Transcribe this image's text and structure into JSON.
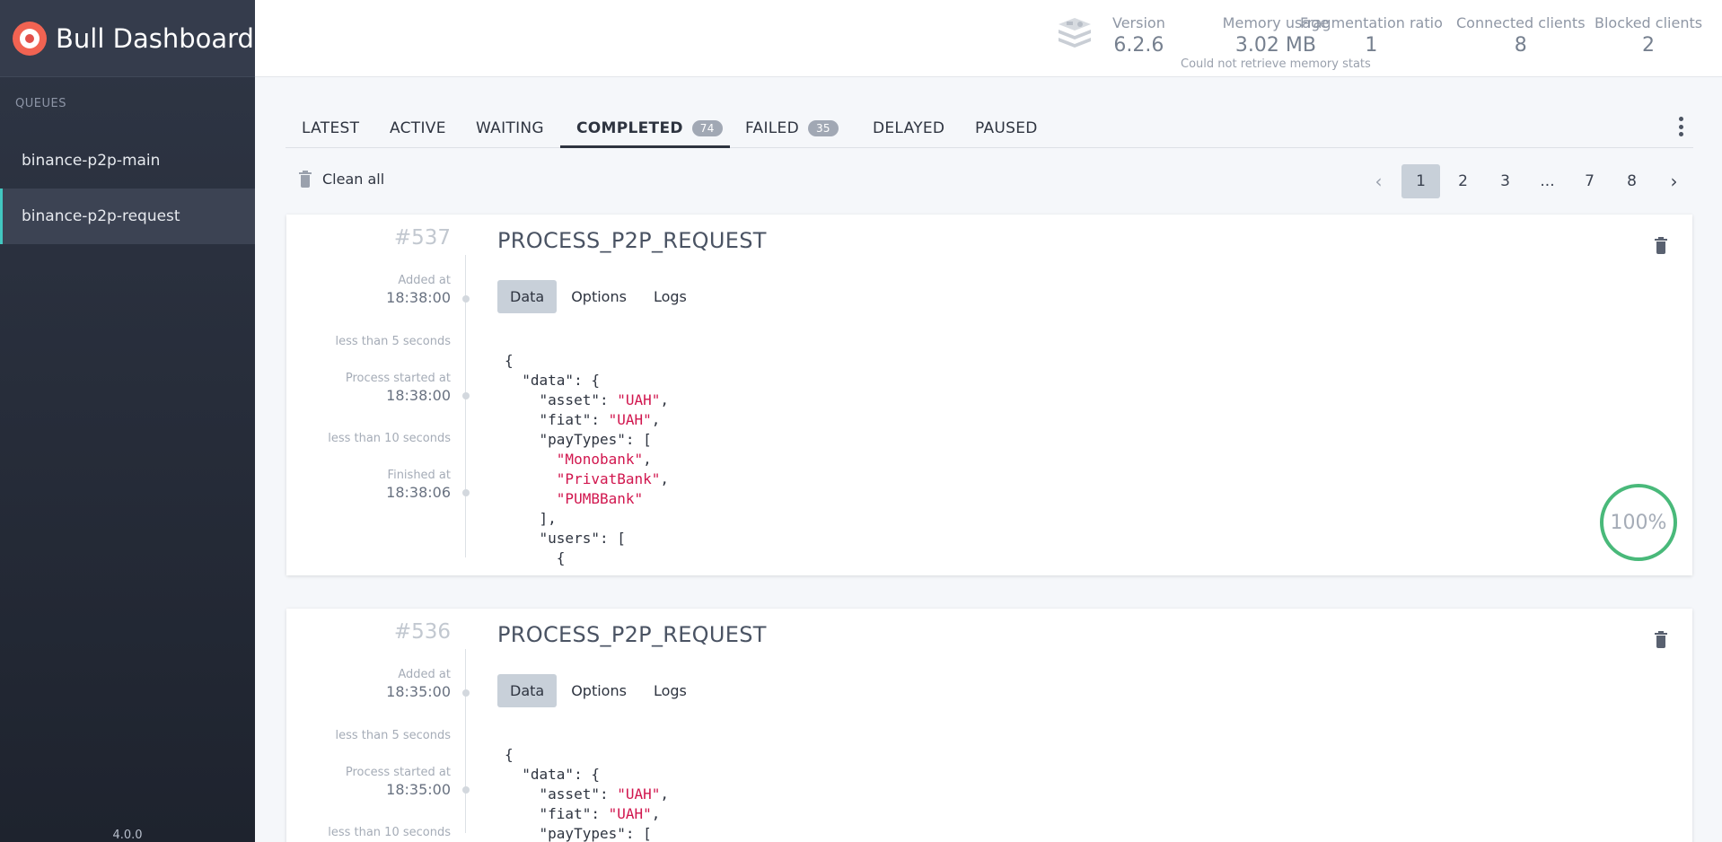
{
  "app": {
    "title": "Bull Dashboard",
    "version": "4.0.0"
  },
  "sidebar": {
    "section_title": "QUEUES",
    "items": [
      {
        "label": "binance-p2p-main"
      },
      {
        "label": "binance-p2p-request"
      }
    ]
  },
  "header": {
    "stats": [
      {
        "label": "Version",
        "value": "6.2.6"
      },
      {
        "label": "Memory usage",
        "value": "3.02 MB",
        "sub": "Could not retrieve memory stats"
      },
      {
        "label": "Fragmentation ratio",
        "value": "1"
      },
      {
        "label": "Connected clients",
        "value": "8"
      },
      {
        "label": "Blocked clients",
        "value": "2"
      }
    ]
  },
  "tabs": [
    {
      "label": "LATEST"
    },
    {
      "label": "ACTIVE"
    },
    {
      "label": "WAITING"
    },
    {
      "label": "COMPLETED",
      "count": "74"
    },
    {
      "label": "FAILED",
      "count": "35"
    },
    {
      "label": "DELAYED"
    },
    {
      "label": "PAUSED"
    }
  ],
  "toolbar": {
    "clean_all": "Clean all"
  },
  "pagination": {
    "pages": [
      "1",
      "2",
      "3",
      "...",
      "7",
      "8"
    ],
    "current": "1",
    "prev": "‹",
    "next": "›"
  },
  "job_tabs": {
    "data": "Data",
    "options": "Options",
    "logs": "Logs"
  },
  "jobs": [
    {
      "id": "#537",
      "name": "PROCESS_P2P_REQUEST",
      "added_label": "Added at",
      "added_time": "18:38:00",
      "delta1": "less than 5 seconds",
      "started_label": "Process started at",
      "started_time": "18:38:00",
      "delta2": "less than 10 seconds",
      "finished_label": "Finished at",
      "finished_time": "18:38:06",
      "progress": "100%",
      "code_lines": [
        "{",
        "  \"data\": {",
        "    \"asset\": \"UAH\",",
        "    \"fiat\": \"UAH\",",
        "    \"payTypes\": [",
        "      \"Monobank\",",
        "      \"PrivatBank\",",
        "      \"PUMBBank\"",
        "    ],",
        "    \"users\": [",
        "      {"
      ]
    },
    {
      "id": "#536",
      "name": "PROCESS_P2P_REQUEST",
      "added_label": "Added at",
      "added_time": "18:35:00",
      "delta1": "less than 5 seconds",
      "started_label": "Process started at",
      "started_time": "18:35:00",
      "delta2": "less than 10 seconds",
      "code_lines": [
        "{",
        "  \"data\": {",
        "    \"asset\": \"UAH\",",
        "    \"fiat\": \"UAH\",",
        "    \"payTypes\": ["
      ]
    }
  ]
}
